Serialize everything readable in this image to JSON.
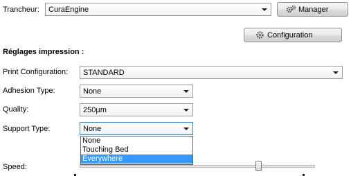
{
  "slicer": {
    "label": "Trancheur:",
    "value": "CuraEngine",
    "manager_button": "Manager",
    "configuration_button": "Configuration"
  },
  "print_settings": {
    "section_title": "Réglages impression :",
    "print_configuration": {
      "label": "Print Configuration:",
      "value": "STANDARD"
    },
    "adhesion_type": {
      "label": "Adhesion Type:",
      "value": "None"
    },
    "quality": {
      "label": "Quality:",
      "value": "250µm"
    },
    "support_type": {
      "label": "Support Type:",
      "value": "None",
      "options": [
        "None",
        "Touching Bed",
        "Everywhere"
      ],
      "highlighted_option": "Everywhere"
    },
    "speed": {
      "label": "Speed:"
    }
  },
  "icons": {
    "manager": "gears-icon",
    "configuration": "gear-icon",
    "dropdown": "chevron-down-icon"
  },
  "colors": {
    "highlight": "#3399ff",
    "focus_border": "#3c7fb1"
  }
}
